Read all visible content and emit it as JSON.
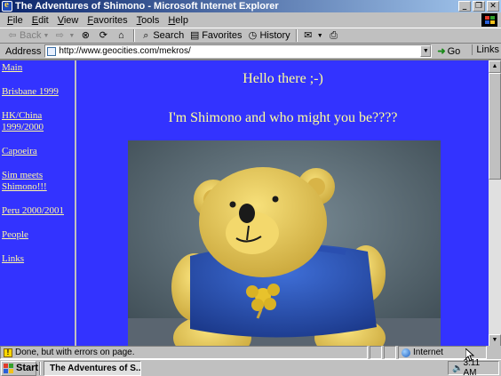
{
  "window": {
    "title": "The Adventures of Shimono - Microsoft Internet Explorer",
    "controls": [
      "_",
      "❐",
      "✕"
    ]
  },
  "menu": [
    "File",
    "Edit",
    "View",
    "Favorites",
    "Tools",
    "Help"
  ],
  "toolbar": {
    "back": "Back",
    "forward": "",
    "search": "Search",
    "favorites": "Favorites",
    "history": "History"
  },
  "address": {
    "label": "Address",
    "url": "http://www.geocities.com/mekros/",
    "go": "Go",
    "links": "Links"
  },
  "nav": [
    "Main",
    "Brisbane 1999",
    "HK/China 1999/2000",
    "Capoeira",
    "Sim meets Shimono!!!",
    "Peru 2000/2001",
    "People",
    "Links"
  ],
  "page": {
    "greeting": "Hello there ;-)",
    "intro": "I'm Shimono and who might you be????",
    "link_color": "#fff8a0",
    "background_color": "#3333ff",
    "text_color": "#ffff99"
  },
  "status": {
    "text": "Done, but with errors on page.",
    "zone": "Internet"
  },
  "taskbar": {
    "start": "Start",
    "task": "The Adventures of S...",
    "clock": "3:11 AM"
  }
}
